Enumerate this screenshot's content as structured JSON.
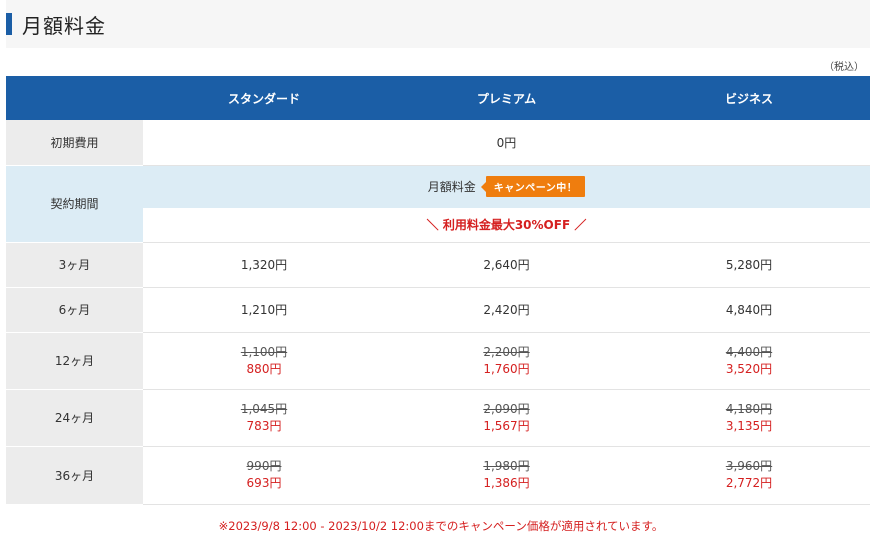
{
  "title": "月額料金",
  "tax_note": "（税込）",
  "plans": [
    "スタンダード",
    "プレミアム",
    "ビジネス"
  ],
  "initial_fee": {
    "label": "初期費用",
    "value": "0円"
  },
  "contract": {
    "label": "契約期間",
    "monthly_fee_label": "月額料金",
    "campaign_badge": "キャンペーン中！",
    "discount_text": "＼ 利用料金最大30%OFF ／"
  },
  "rows": [
    {
      "period": "3ヶ月",
      "prices": [
        {
          "regular": "1,320円"
        },
        {
          "regular": "2,640円"
        },
        {
          "regular": "5,280円"
        }
      ]
    },
    {
      "period": "6ヶ月",
      "prices": [
        {
          "regular": "1,210円"
        },
        {
          "regular": "2,420円"
        },
        {
          "regular": "4,840円"
        }
      ]
    },
    {
      "period": "12ヶ月",
      "prices": [
        {
          "old": "1,100円",
          "new": "880円"
        },
        {
          "old": "2,200円",
          "new": "1,760円"
        },
        {
          "old": "4,400円",
          "new": "3,520円"
        }
      ]
    },
    {
      "period": "24ヶ月",
      "prices": [
        {
          "old": "1,045円",
          "new": "783円"
        },
        {
          "old": "2,090円",
          "new": "1,567円"
        },
        {
          "old": "4,180円",
          "new": "3,135円"
        }
      ]
    },
    {
      "period": "36ヶ月",
      "prices": [
        {
          "old": "990円",
          "new": "693円"
        },
        {
          "old": "1,980円",
          "new": "1,386円"
        },
        {
          "old": "3,960円",
          "new": "2,772円"
        }
      ]
    }
  ],
  "footnote": "※2023/9/8 12:00 - 2023/10/2 12:00までのキャンペーン価格が適用されています。",
  "colors": {
    "header_blue": "#1b5ea6",
    "campaign_orange": "#ef7d0e",
    "discount_red": "#d52020",
    "contract_bg": "#dcecf5"
  }
}
